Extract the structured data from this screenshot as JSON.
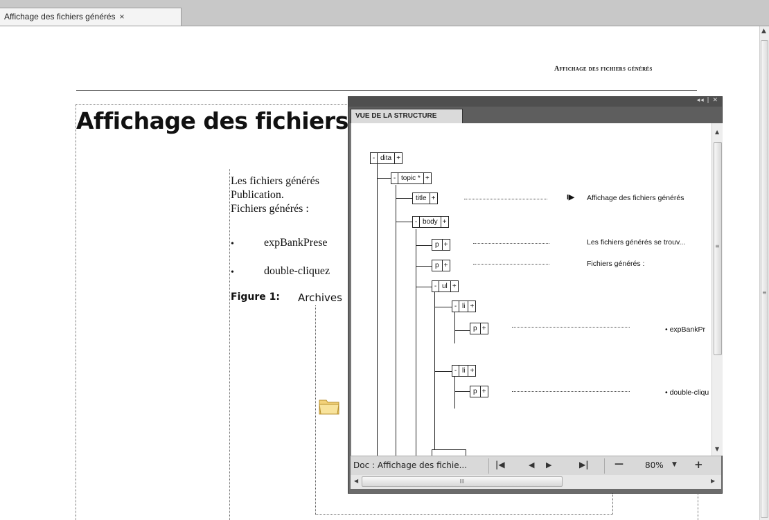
{
  "tab": {
    "label": "Affichage des fichiers générés",
    "close": "×"
  },
  "page": {
    "running_head": "Affichage des fichiers générés",
    "title": "Affichage des fichiers",
    "para1_line1": "Les fichiers générés",
    "para1_line2": "Publication.",
    "para2": "Fichiers générés :",
    "bullet_char": "•",
    "bullet1": "expBankPrese",
    "bullet2": "double-cliquez",
    "figure_label": "Figure 1:",
    "figure_caption": "Archives"
  },
  "panel": {
    "tab_title": "VUE DE LA STRUCTURE",
    "bar_controls": "◂◂ | ✕",
    "tree": {
      "dita": "dita",
      "topic": "topic *",
      "title": "title",
      "body": "body",
      "p1": "p",
      "p2": "p",
      "ul": "ul",
      "li1": "li",
      "p3": "p",
      "li2": "li",
      "p4": "p",
      "minus": "-",
      "plus": "+"
    },
    "content": {
      "title_text": "Affichage des fichiers générés",
      "title_marker": "I▶",
      "p1_text": "Les fichiers générés se trouv...",
      "p2_text": "Fichiers générés :",
      "li1_text": "• expBankPr",
      "li2_text": "• double-cliqu"
    },
    "status": {
      "doc": "Doc : Affichage des fichie...",
      "first": "|◀",
      "prev": "◀",
      "next": "▶",
      "last": "▶|",
      "zoom_out": "—",
      "zoom": "80%",
      "zoom_dropdown": "▼",
      "zoom_in": "+"
    },
    "hscroll_grip": "III"
  },
  "icons": {
    "scroll_up": "▲",
    "scroll_down": "▼",
    "scroll_left": "◀",
    "scroll_right": "▶",
    "grip": "≡"
  }
}
